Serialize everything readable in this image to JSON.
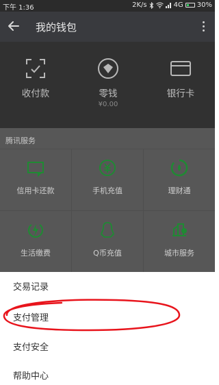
{
  "status_bar": {
    "time": "下午 1:36",
    "speed": "2K/s",
    "network": "4G",
    "battery": "30%"
  },
  "app_bar": {
    "title": "我的钱包"
  },
  "wallet": {
    "items": [
      {
        "label": "收付款",
        "icon": "scan-frame-icon"
      },
      {
        "label": "零钱",
        "sub": "¥0.00",
        "icon": "coin-icon"
      },
      {
        "label": "银行卡",
        "icon": "card-icon"
      }
    ]
  },
  "services": {
    "title": "腾讯服务",
    "items": [
      {
        "label": "信用卡还款",
        "icon": "credit-card-icon"
      },
      {
        "label": "手机充值",
        "icon": "yuan-circle-icon"
      },
      {
        "label": "理财通",
        "icon": "wealth-icon"
      },
      {
        "label": "生活缴费",
        "icon": "bolt-icon"
      },
      {
        "label": "Q币充值",
        "icon": "penguin-icon"
      },
      {
        "label": "城市服务",
        "icon": "city-icon"
      }
    ]
  },
  "menu": {
    "items": [
      {
        "label": "交易记录"
      },
      {
        "label": "支付管理"
      },
      {
        "label": "支付安全"
      },
      {
        "label": "帮助中心"
      }
    ]
  },
  "colors": {
    "accent_green": "#1aad19",
    "annotation_red": "#e8141c"
  }
}
